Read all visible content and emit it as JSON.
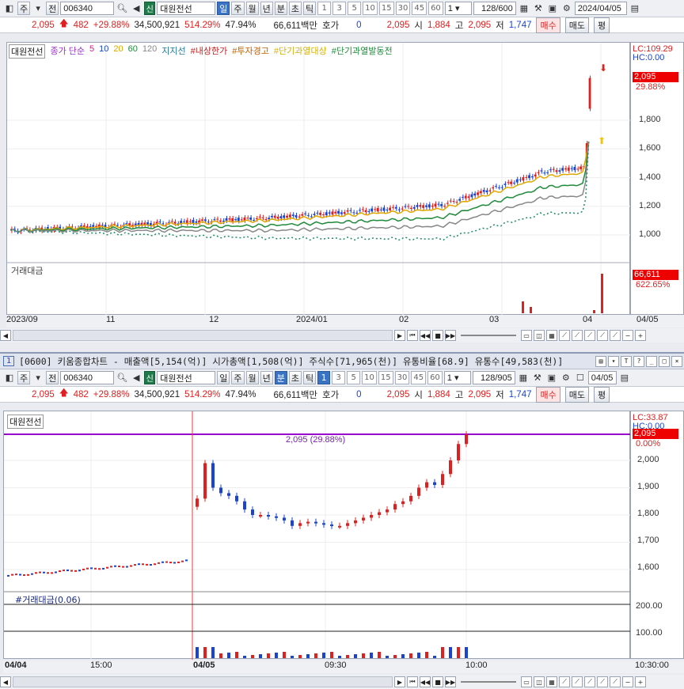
{
  "w1": {
    "toolbar": {
      "b1": "주",
      "b2": "전",
      "code": "006340",
      "badge": "신",
      "name": "대원전선",
      "periods": [
        "일",
        "주",
        "월",
        "년",
        "분",
        "초",
        "틱"
      ],
      "nums": [
        "1",
        "3",
        "5",
        "10",
        "15",
        "30",
        "45",
        "60"
      ],
      "count": "1",
      "ratio": "128",
      "ratio_total": "/600",
      "date": "2024/04/05"
    },
    "price": {
      "price": "2,095",
      "change": "482",
      "pct": "+29.88%",
      "volume": "34,500,921",
      "vol_pct": "514.29%",
      "turn": "47.94%",
      "amount": "66,611백만",
      "hoga_label": "호가",
      "hoga": "0",
      "cur": "2,095",
      "open_l": "시",
      "open": "1,884",
      "high_l": "고",
      "high": "2,095",
      "low_l": "저",
      "low": "1,747",
      "buy": "매수",
      "sell": "매도",
      "eval": "평"
    },
    "legend": {
      "name": "대원전선",
      "ma": "종가 단순",
      "ma5": "5",
      "ma10": "10",
      "ma20": "20",
      "ma60": "60",
      "ma120": "120",
      "support": "지지선",
      "limit": "#내상한가",
      "warn": "#투자경고",
      "overheat": "#단기과열대상",
      "overheat2": "#단기과열발동전"
    },
    "yaxis": {
      "lc": "LC:109.29",
      "hc": "HC:0.00",
      "cur": "2,095",
      "pct": "29.88%",
      "ticks": [
        "1,800",
        "1,600",
        "1,400",
        "1,200",
        "1,000"
      ]
    },
    "vol": {
      "label": "거래대금",
      "val": "66,611",
      "pct": "622.65%"
    },
    "xaxis": [
      "2023/09",
      "11",
      "12",
      "2024/01",
      "02",
      "03",
      "04",
      "04/05"
    ]
  },
  "w2": {
    "title": {
      "num": "1",
      "text": "[0600] 키움종합차트 - 매출액[5,154(억)] 시가총액[1,508(억)] 주식수[71,965(천)] 유통비율[68.9] 유통수[49,583(천)]"
    },
    "toolbar": {
      "b1": "주",
      "b2": "전",
      "code": "006340",
      "badge": "신",
      "name": "대원전선",
      "periods": [
        "일",
        "주",
        "월",
        "년",
        "분",
        "초",
        "틱"
      ],
      "nums": [
        "1",
        "3",
        "5",
        "10",
        "15",
        "30",
        "45",
        "60"
      ],
      "count": "1",
      "ratio": "128",
      "ratio_total": "/905",
      "date": "04/05"
    },
    "legend": {
      "name": "대원전선"
    },
    "line_label": "2,095 (29.88%)",
    "yaxis": {
      "lc": "LC:33.87",
      "hc": "HC:0.00",
      "cur": "2,095",
      "pct": "0.00%",
      "ticks": [
        "2,000",
        "1,900",
        "1,800",
        "1,700",
        "1,600"
      ]
    },
    "vol": {
      "label": "#거래대금(0.06)",
      "ticks": [
        "200.00",
        "100.00"
      ]
    },
    "xaxis": [
      "04/04",
      "15:00",
      "04/05",
      "09:30",
      "10:00",
      "10:30:00"
    ]
  },
  "colors": {
    "up": "#e02020",
    "down": "#1a43d6",
    "ma5": "#e0208c",
    "ma10": "#1a43d6",
    "ma20": "#e0a800",
    "ma60": "#1f8a3a",
    "ma120": "#888888",
    "line": "#9900cc"
  }
}
